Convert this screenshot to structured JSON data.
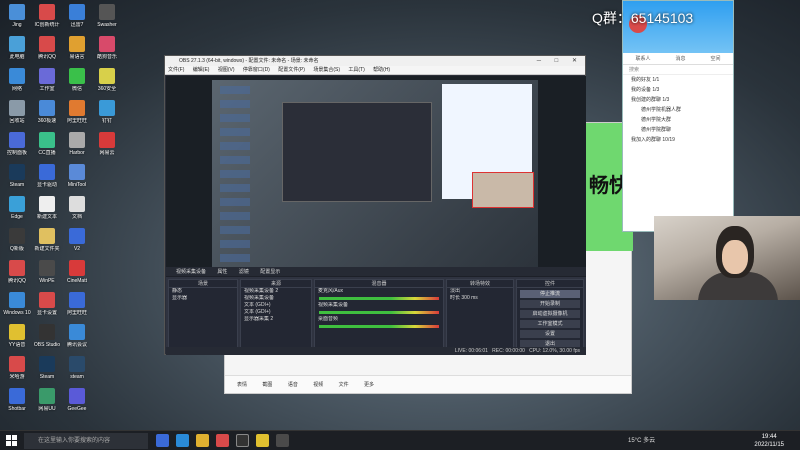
{
  "desktop": {
    "icons": [
      {
        "label": "Jing",
        "color": "#4a8fd8",
        "col": 0,
        "row": 0
      },
      {
        "label": "IC创新统计",
        "color": "#d84a4a",
        "col": 1,
        "row": 0
      },
      {
        "label": "迅雷7",
        "color": "#3a7fd8",
        "col": 2,
        "row": 0
      },
      {
        "label": "Swasher",
        "color": "#555",
        "col": 3,
        "row": 0
      },
      {
        "label": "此电脑",
        "color": "#4aa0d8",
        "col": 0,
        "row": 1
      },
      {
        "label": "腾讯QQ",
        "color": "#d84a4a",
        "col": 1,
        "row": 1
      },
      {
        "label": "易语言",
        "color": "#e0a030",
        "col": 2,
        "row": 1
      },
      {
        "label": "酷狗音乐",
        "color": "#d84a6a",
        "col": 3,
        "row": 1
      },
      {
        "label": "网络",
        "color": "#3a8ad8",
        "col": 0,
        "row": 2
      },
      {
        "label": "工作室",
        "color": "#6a6ad8",
        "col": 1,
        "row": 2
      },
      {
        "label": "微信",
        "color": "#3ac04a",
        "col": 2,
        "row": 2
      },
      {
        "label": "360安全",
        "color": "#d8d04a",
        "col": 3,
        "row": 2
      },
      {
        "label": "回收站",
        "color": "#8a9aa8",
        "col": 0,
        "row": 3
      },
      {
        "label": "360极速",
        "color": "#4a8ad8",
        "col": 1,
        "row": 3
      },
      {
        "label": "阿里旺旺",
        "color": "#e07a30",
        "col": 2,
        "row": 3
      },
      {
        "label": "钉钉",
        "color": "#3a9ad8",
        "col": 3,
        "row": 3
      },
      {
        "label": "控制面板",
        "color": "#4a6ad8",
        "col": 0,
        "row": 4
      },
      {
        "label": "CC直播",
        "color": "#3ac08a",
        "col": 1,
        "row": 4
      },
      {
        "label": "Harbor",
        "color": "#aaa",
        "col": 2,
        "row": 4
      },
      {
        "label": "网易云",
        "color": "#d83a3a",
        "col": 3,
        "row": 4
      },
      {
        "label": "Steam",
        "color": "#1a3a5a",
        "col": 0,
        "row": 5
      },
      {
        "label": "显卡驱动",
        "color": "#3a6ad8",
        "col": 1,
        "row": 5
      },
      {
        "label": "MiniTool",
        "color": "#5a8ad8",
        "col": 2,
        "row": 5
      },
      {
        "label": "Edge",
        "color": "#3aa0d8",
        "col": 0,
        "row": 6
      },
      {
        "label": "新建文本",
        "color": "#eee",
        "col": 1,
        "row": 6
      },
      {
        "label": "文档",
        "color": "#ddd",
        "col": 2,
        "row": 6
      },
      {
        "label": "Q新版",
        "color": "#3a3a3a",
        "col": 0,
        "row": 7
      },
      {
        "label": "新建文件夹",
        "color": "#e0c060",
        "col": 1,
        "row": 7
      },
      {
        "label": "V2",
        "color": "#3a6ad8",
        "col": 2,
        "row": 7
      },
      {
        "label": "腾讯QQ",
        "color": "#d84a4a",
        "col": 0,
        "row": 8
      },
      {
        "label": "WinPE",
        "color": "#4a4a4a",
        "col": 1,
        "row": 8
      },
      {
        "label": "CineMatt",
        "color": "#d83a3a",
        "col": 2,
        "row": 8
      },
      {
        "label": "Windows 10",
        "color": "#3a8ad8",
        "col": 0,
        "row": 9
      },
      {
        "label": "显卡设置",
        "color": "#d84a4a",
        "col": 1,
        "row": 9
      },
      {
        "label": "阿里旺旺",
        "color": "#3a6ad8",
        "col": 2,
        "row": 9
      },
      {
        "label": "YY语音",
        "color": "#e0c030",
        "col": 0,
        "row": 10
      },
      {
        "label": "OBS Studio",
        "color": "#333",
        "col": 1,
        "row": 10
      },
      {
        "label": "腾讯会议",
        "color": "#3a8ad8",
        "col": 2,
        "row": 10
      },
      {
        "label": "米哈游",
        "color": "#d84a4a",
        "col": 0,
        "row": 11
      },
      {
        "label": "Steam",
        "color": "#1a3a5a",
        "col": 1,
        "row": 11
      },
      {
        "label": "steam",
        "color": "#2a4a6a",
        "col": 2,
        "row": 11
      },
      {
        "label": "Shotbar",
        "color": "#3a6ad8",
        "col": 0,
        "row": 12
      },
      {
        "label": "网易UU",
        "color": "#3a9a6a",
        "col": 1,
        "row": 12
      },
      {
        "label": "GeeGee",
        "color": "#5a5ad8",
        "col": 2,
        "row": 12
      }
    ]
  },
  "overlay": {
    "group_text": "Q群：65145103"
  },
  "obs": {
    "title": "OBS 27.1.3 (64-bit, windows) - 配置文件: 未命名 - 场景: 未命名",
    "menu": [
      "文件(F)",
      "编辑(E)",
      "视图(V)",
      "停靠窗口(D)",
      "配置文件(P)",
      "场景集合(S)",
      "工具(T)",
      "帮助(H)"
    ],
    "toolbar": [
      "视频采集设备",
      "属性",
      "滤镜",
      "配置显示"
    ],
    "scenes_header": "场景",
    "scenes": [
      "静态",
      "显示器"
    ],
    "sources_header": "来源",
    "sources": [
      "视频采集设备 2",
      "视频采集设备",
      "文本 (GDI+)",
      "文本 (GDI+)",
      "显示器采集 2"
    ],
    "mixer_header": "混音器",
    "mixer_tracks": [
      {
        "name": "麦克风/Aux",
        "db": "0.0 dB"
      },
      {
        "name": "视频采集设备",
        "db": "0.0 dB"
      },
      {
        "name": "桌面音频",
        "db": "0.0 dB"
      }
    ],
    "transitions_header": "转场特效",
    "transition_type": "淡出",
    "duration_label": "时长",
    "duration_value": "300 ms",
    "controls_header": "控件",
    "controls": [
      "停止推流",
      "开始录制",
      "启动虚拟摄像机",
      "工作室模式",
      "设置",
      "退出"
    ],
    "status": "CPU: 12.0%, 30.00 fps",
    "status_live": "LIVE: 00:06:01",
    "status_rec": "REC: 00:00:00"
  },
  "qq": {
    "tabs": [
      "联系人",
      "消息",
      "空间"
    ],
    "search": "搜索",
    "items": [
      {
        "label": "我的好友 1/1",
        "group": false
      },
      {
        "label": "我的设备 1/3",
        "group": false
      },
      {
        "label": "我创建的群聊 1/3",
        "group": false
      },
      {
        "label": "德州学院机器人群",
        "group": true
      },
      {
        "label": "德州学院大群",
        "group": true
      },
      {
        "label": "德州学院群聊",
        "group": true
      },
      {
        "label": "我加入的群聊 10/19",
        "group": false
      }
    ]
  },
  "chat": {
    "side_text": "畅快",
    "bottom_items": [
      "表情",
      "截图",
      "语音",
      "视频",
      "文件",
      "更多"
    ]
  },
  "taskbar": {
    "search_placeholder": "在这里输入你要搜索的内容",
    "weather": "15°C 多云",
    "time": "19:44",
    "date": "2022/11/15"
  }
}
